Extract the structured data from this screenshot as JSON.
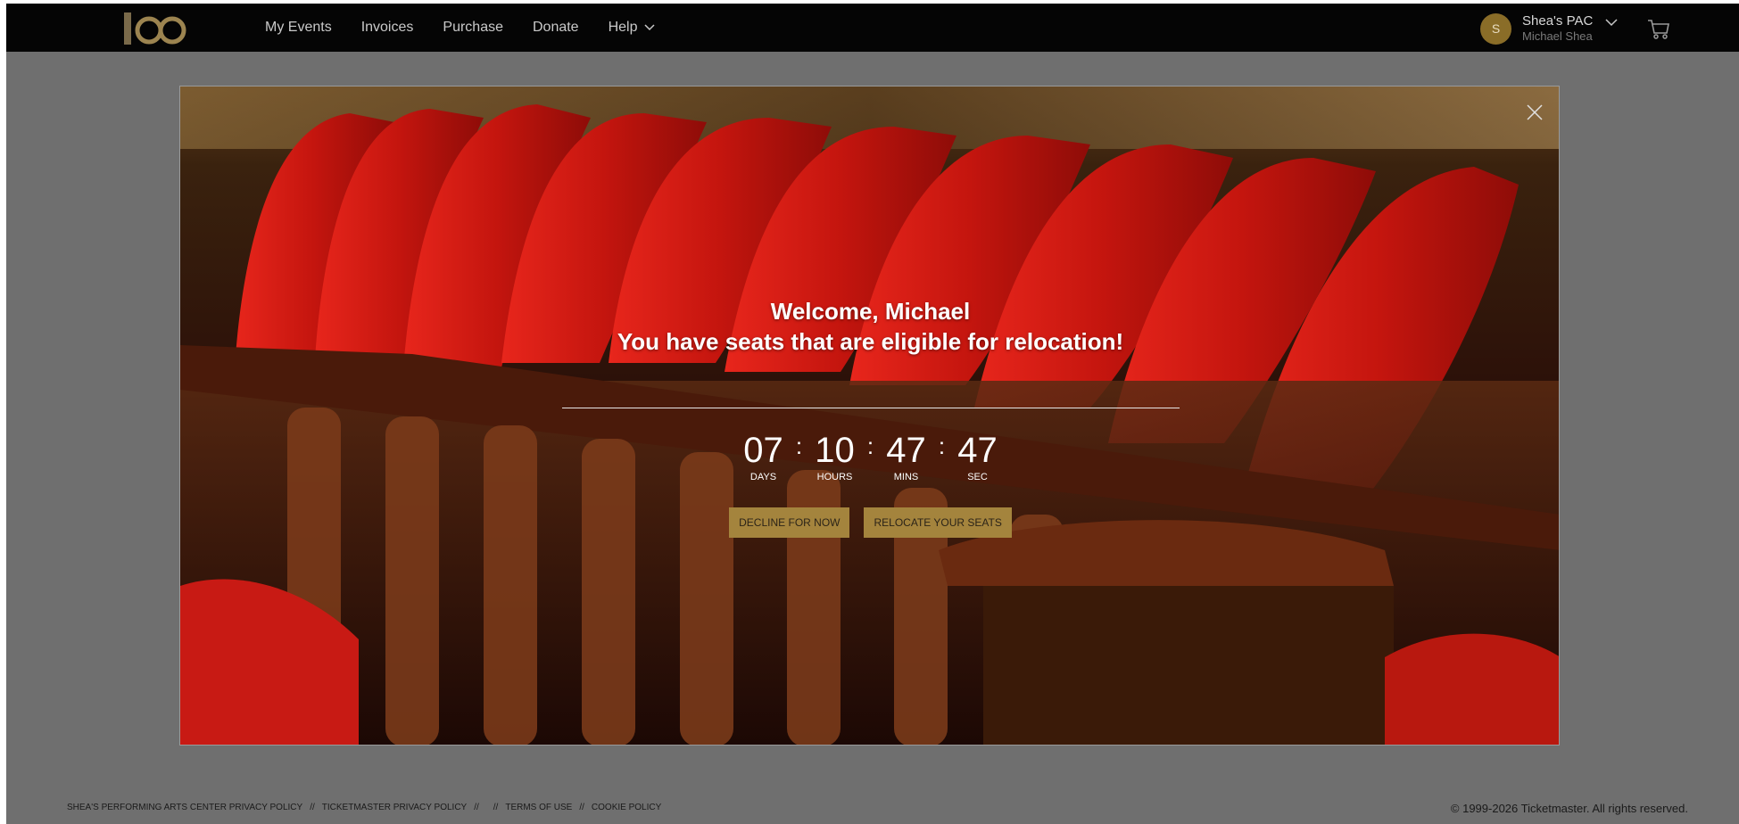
{
  "nav": {
    "items": [
      {
        "label": "My Events"
      },
      {
        "label": "Invoices"
      },
      {
        "label": "Purchase"
      },
      {
        "label": "Donate"
      },
      {
        "label": "Help"
      }
    ]
  },
  "user": {
    "avatar_initial": "S",
    "org": "Shea's PAC",
    "name": "Michael Shea"
  },
  "modal": {
    "welcome_line1": "Welcome, Michael",
    "welcome_line2": "You have seats that are eligible for relocation!",
    "countdown": [
      {
        "value": "07",
        "label": "DAYS"
      },
      {
        "value": "10",
        "label": "HOURS"
      },
      {
        "value": "47",
        "label": "MINS"
      },
      {
        "value": "47",
        "label": "SEC"
      }
    ],
    "separator": ":",
    "decline_label": "DECLINE FOR NOW",
    "relocate_label": "RELOCATE YOUR SEATS"
  },
  "footer": {
    "links": [
      "SHEA'S PERFORMING ARTS CENTER PRIVACY POLICY",
      "TICKETMASTER PRIVACY POLICY",
      "",
      "TERMS OF USE",
      "COOKIE POLICY"
    ],
    "separator": "//",
    "copyright": "© 1999-2026 Ticketmaster. All rights reserved."
  },
  "colors": {
    "topbar": "#050505",
    "overlay": "#6f6f6f",
    "button": "#a4843d",
    "avatar": "#8a6d28"
  },
  "icons": [
    "venue-logo-icon",
    "chevron-down-icon",
    "cart-icon",
    "close-icon"
  ]
}
